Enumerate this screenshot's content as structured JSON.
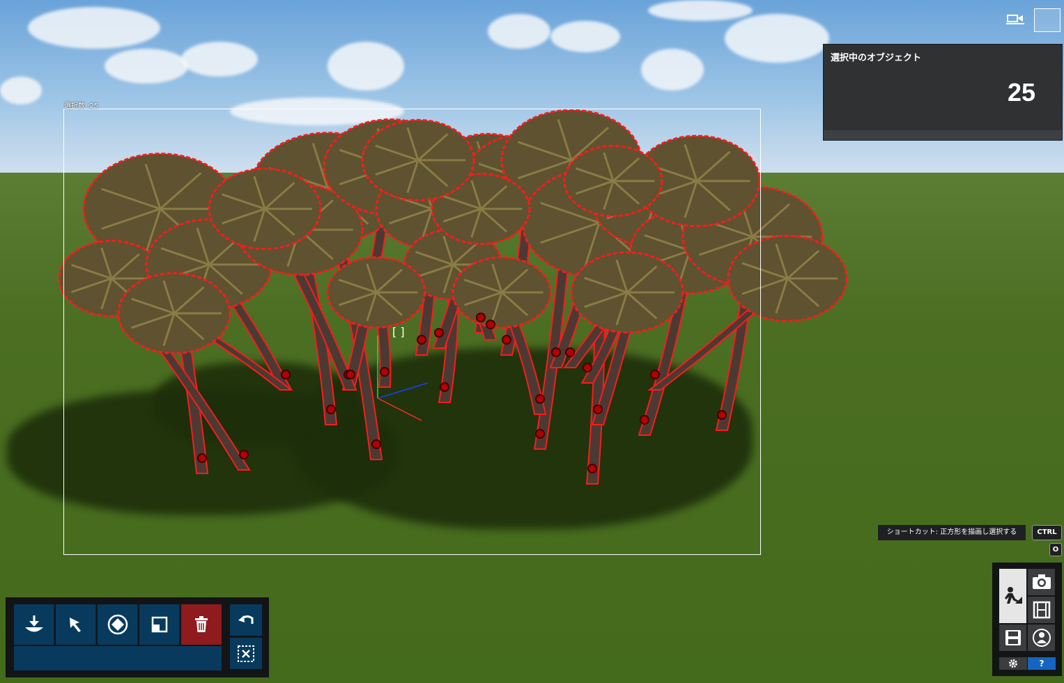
{
  "viewport": {
    "selection_count_label": "選択数 :25"
  },
  "info_panel": {
    "title": "選択中のオブジェクト",
    "count": "25"
  },
  "shortcut": {
    "tip": "ショートカット: 正方形を描画し選択する",
    "key_primary": "CTRL",
    "key_secondary": "O"
  },
  "toolbar": {
    "tools": [
      {
        "name": "place-icon"
      },
      {
        "name": "select-arrow-icon"
      },
      {
        "name": "rotate-icon"
      },
      {
        "name": "scale-icon"
      },
      {
        "name": "trash-icon"
      }
    ],
    "side": [
      {
        "name": "undo-icon"
      },
      {
        "name": "deselect-icon"
      }
    ]
  },
  "right_panel": {
    "buttons": [
      {
        "name": "build-mode-icon",
        "active": true
      },
      {
        "name": "camera-icon",
        "active": false
      },
      {
        "name": "film-icon",
        "active": false
      },
      {
        "name": "save-icon",
        "active": false
      },
      {
        "name": "avatar-icon",
        "active": false
      }
    ],
    "help_label": "?",
    "colors": {
      "help_bg": "#1565c0",
      "settings_bg": "#3b3d3f"
    }
  },
  "colors": {
    "selection_outline": "#ff1a1a",
    "toolbar_blue": "#083a5e",
    "delete_red": "#8f1b1f",
    "panel_dark": "#2f3133"
  }
}
